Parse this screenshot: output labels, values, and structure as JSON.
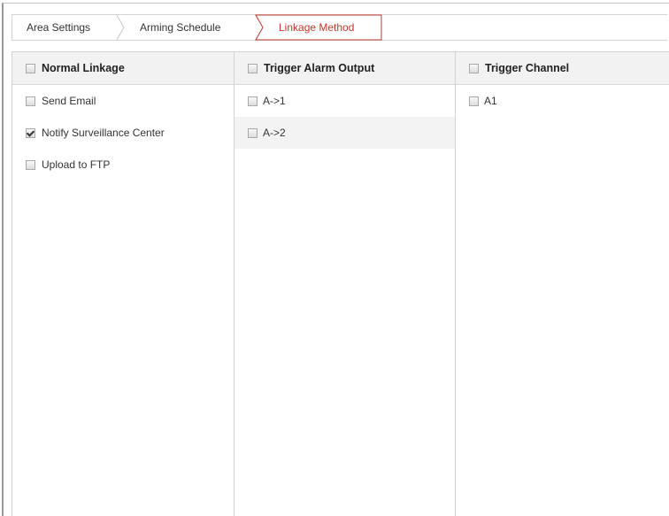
{
  "tabs": [
    {
      "label": "Area Settings",
      "active": false
    },
    {
      "label": "Arming Schedule",
      "active": false
    },
    {
      "label": "Linkage Method",
      "active": true
    }
  ],
  "columns": {
    "normal_linkage": {
      "header": "Normal Linkage",
      "header_checked": false,
      "items": [
        {
          "label": "Send Email",
          "checked": false
        },
        {
          "label": "Notify Surveillance Center",
          "checked": true
        },
        {
          "label": "Upload to FTP",
          "checked": false
        }
      ]
    },
    "trigger_alarm_output": {
      "header": "Trigger Alarm Output",
      "header_checked": false,
      "items": [
        {
          "label": "A->1",
          "checked": false
        },
        {
          "label": "A->2",
          "checked": false
        }
      ]
    },
    "trigger_channel": {
      "header": "Trigger Channel",
      "header_checked": false,
      "items": [
        {
          "label": "A1",
          "checked": false
        }
      ]
    }
  },
  "colors": {
    "active_tab": "#c0392b",
    "border": "#d3d3d3",
    "header_bg": "#f2f2f2"
  }
}
